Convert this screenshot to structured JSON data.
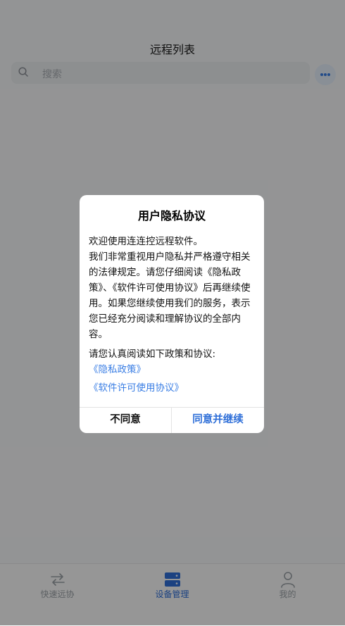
{
  "header": {
    "title": "远程列表"
  },
  "search": {
    "placeholder": "搜索"
  },
  "tabbar": {
    "items": [
      {
        "label": "快速远协",
        "icon": "swap-arrows-icon",
        "active": false
      },
      {
        "label": "设备管理",
        "icon": "server-icon",
        "active": true
      },
      {
        "label": "我的",
        "icon": "person-icon",
        "active": false
      }
    ]
  },
  "dialog": {
    "title": "用户隐私协议",
    "body": "欢迎使用连连控远程软件。\n我们非常重视用户隐私并严格遵守相关的法律规定。请您仔细阅读《隐私政策》、《软件许可使用协议》后再继续使用。如果您继续使用我们的服务，表示您已经充分阅读和理解协议的全部内容。",
    "notice": "请您认真阅读如下政策和协议:",
    "links": [
      "《隐私政策》",
      "《软件许可使用协议》"
    ],
    "decline_label": "不同意",
    "accept_label": "同意并继续"
  },
  "colors": {
    "accent": "#3a7ee4",
    "overlay": "rgba(0,0,0,0.4)"
  }
}
